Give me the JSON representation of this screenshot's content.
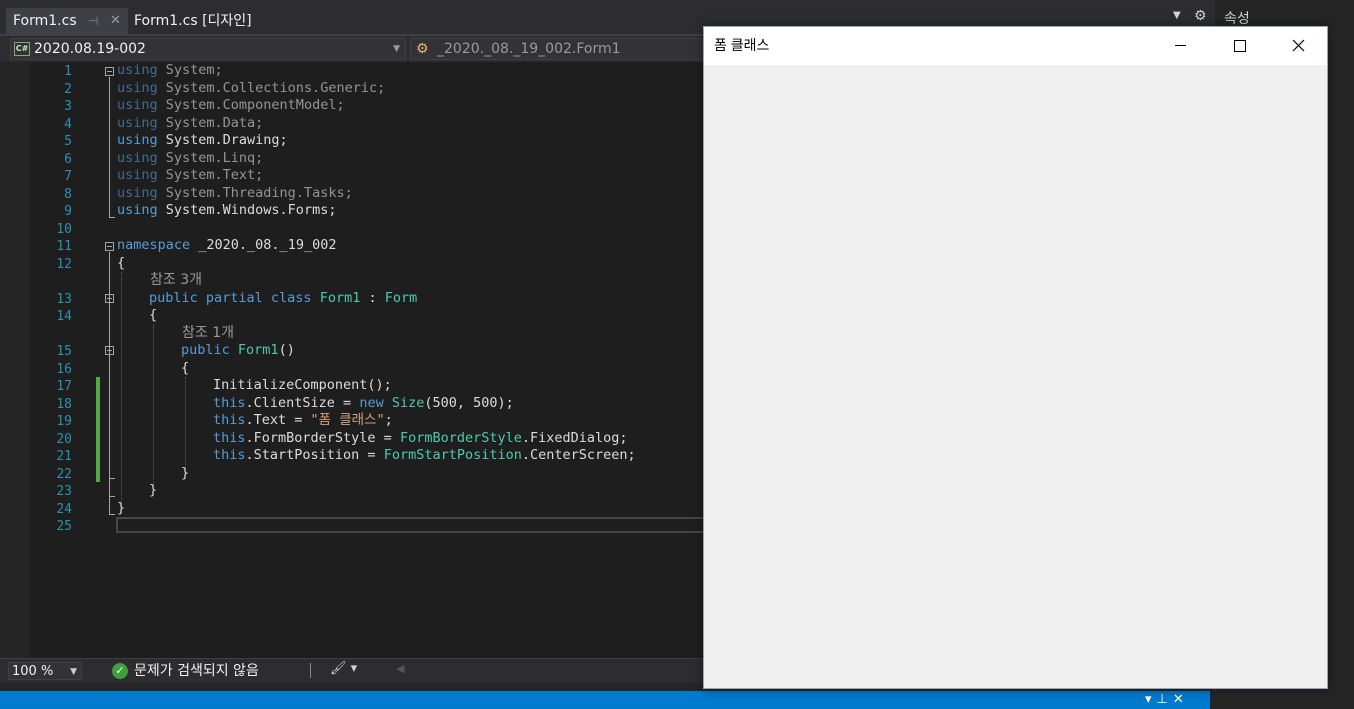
{
  "tabs": [
    {
      "label": "Form1.cs",
      "active": true
    },
    {
      "label": "Form1.cs [디자인]",
      "active": false
    }
  ],
  "navbar": {
    "project": "2020.08.19-002",
    "project_badge": "C#",
    "class": "_2020._08._19_002.Form1"
  },
  "properties_panel": {
    "title": "속성"
  },
  "line_numbers": [
    "1",
    "2",
    "3",
    "4",
    "5",
    "6",
    "7",
    "8",
    "9",
    "10",
    "11",
    "12",
    "13",
    "14",
    "15",
    "16",
    "17",
    "18",
    "19",
    "20",
    "21",
    "22",
    "23",
    "24",
    "25"
  ],
  "code": {
    "l1": {
      "kw": "using",
      "rest": " System;"
    },
    "l2": {
      "kw": "using",
      "rest": " System.Collections.Generic;"
    },
    "l3": {
      "kw": "using",
      "rest": " System.ComponentModel;"
    },
    "l4": {
      "kw": "using",
      "rest": " System.Data;"
    },
    "l5": {
      "kw": "using",
      "rest": " System.Drawing;"
    },
    "l6": {
      "kw": "using",
      "rest": " System.Linq;"
    },
    "l7": {
      "kw": "using",
      "rest": " System.Text;"
    },
    "l8": {
      "kw": "using",
      "rest": " System.Threading.Tasks;"
    },
    "l9": {
      "kw": "using",
      "rest": " System.Windows.Forms;"
    },
    "l11": {
      "kw": "namespace",
      "rest": " _2020._08._19_002"
    },
    "l12": "{",
    "lens_class": "참조 3개",
    "l13": {
      "kw": "public partial class",
      "type": "Form1",
      "mid": " : ",
      "base": "Form"
    },
    "l14": "{",
    "lens_ctor": "참조 1개",
    "l15": {
      "kw": "public",
      "type": "Form1",
      "rest": "()"
    },
    "l16": "{",
    "l17": "InitializeComponent();",
    "l18": {
      "this": "this",
      "a": ".ClientSize = ",
      "new": "new",
      "type": "Size",
      "b": "(500, 500);"
    },
    "l19": {
      "this": "this",
      "a": ".Text = ",
      "str": "\"폼 클래스\"",
      "b": ";"
    },
    "l20": {
      "this": "this",
      "a": ".FormBorderStyle = ",
      "type": "FormBorderStyle",
      "b": ".FixedDialog;"
    },
    "l21": {
      "this": "this",
      "a": ".StartPosition = ",
      "type": "FormStartPosition",
      "b": ".CenterScreen;"
    },
    "l22": "}",
    "l23": "}",
    "l24": "}"
  },
  "status": {
    "zoom": "100 %",
    "issues": "문제가 검색되지 않음"
  },
  "form_window": {
    "title": "폼 클래스"
  },
  "colors": {
    "keyword": "#569cd6",
    "type": "#4ec9b0",
    "string": "#d69d85",
    "line_number": "#2b91af",
    "change_marker": "#57a64a",
    "status_bar": "#007acc"
  }
}
